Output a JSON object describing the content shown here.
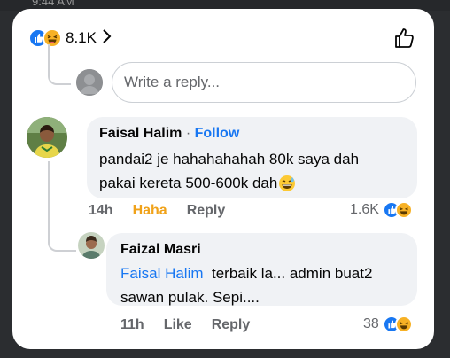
{
  "status": {
    "time": "9:44 AM"
  },
  "post_reactions": {
    "count": "8.1K",
    "icons": [
      "like-icon",
      "haha-icon"
    ]
  },
  "reply_box": {
    "placeholder": "Write a reply..."
  },
  "comments": [
    {
      "author": "Faisal Halim",
      "separator": "·",
      "follow_label": "Follow",
      "line1": "pandai2 je hahahahahah 80k saya dah",
      "line2": "pakai kereta 500-600k dah",
      "emoji": "grinning-sweat-emoji",
      "time": "14h",
      "reaction_label": "Haha",
      "reply_label": "Reply",
      "reaction_count": "1.6K"
    },
    {
      "author": "Faizal Masri",
      "mention": "Faisal Halim",
      "line1_rest": "terbaik la... admin buat2",
      "line2": "sawan pulak. Sepi....",
      "time": "11h",
      "like_label": "Like",
      "reply_label": "Reply",
      "reaction_count": "38"
    }
  ],
  "colors": {
    "accent": "#1877f2",
    "haha": "#f7b125",
    "bubble": "#f0f2f5"
  }
}
